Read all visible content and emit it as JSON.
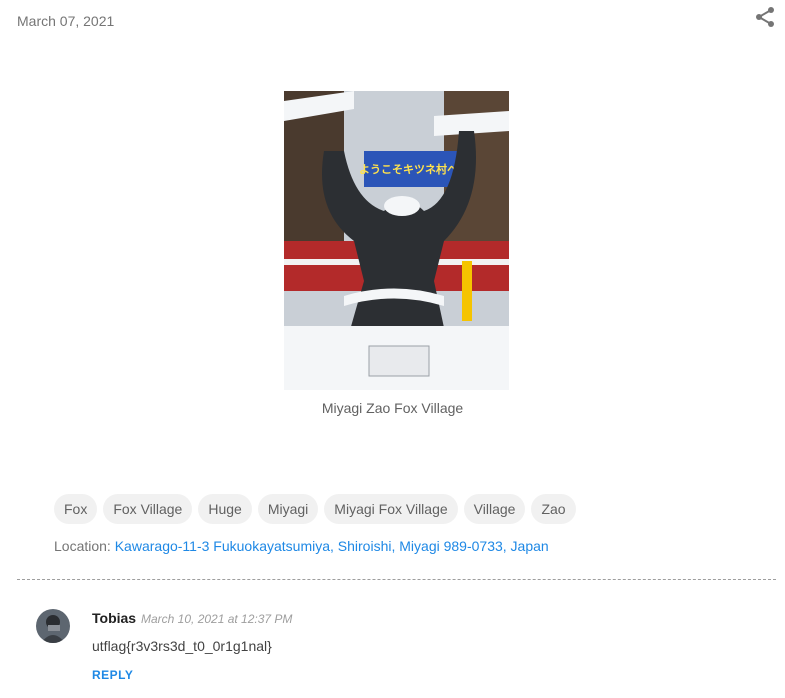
{
  "post": {
    "date": "March 07, 2021",
    "image_caption": "Miyagi Zao Fox Village",
    "image_sign_text": "ようこそキツネ村へ!",
    "labels": [
      "Fox",
      "Fox Village",
      "Huge",
      "Miyagi",
      "Miyagi Fox Village",
      "Village",
      "Zao"
    ],
    "location_label": "Location:",
    "location_value": "Kawarago-11-3 Fukuokayatsumiya, Shiroishi, Miyagi 989-0733, Japan"
  },
  "share": {
    "icon": "share-icon"
  },
  "comment": {
    "author": "Tobias",
    "timestamp": "March 10, 2021 at 12:37 PM",
    "text": "utflag{r3v3rs3d_t0_0r1g1nal}",
    "reply_label": "REPLY"
  },
  "colors": {
    "link": "#1e88e5",
    "chip_bg": "#f1f1f1",
    "muted": "#757575"
  }
}
